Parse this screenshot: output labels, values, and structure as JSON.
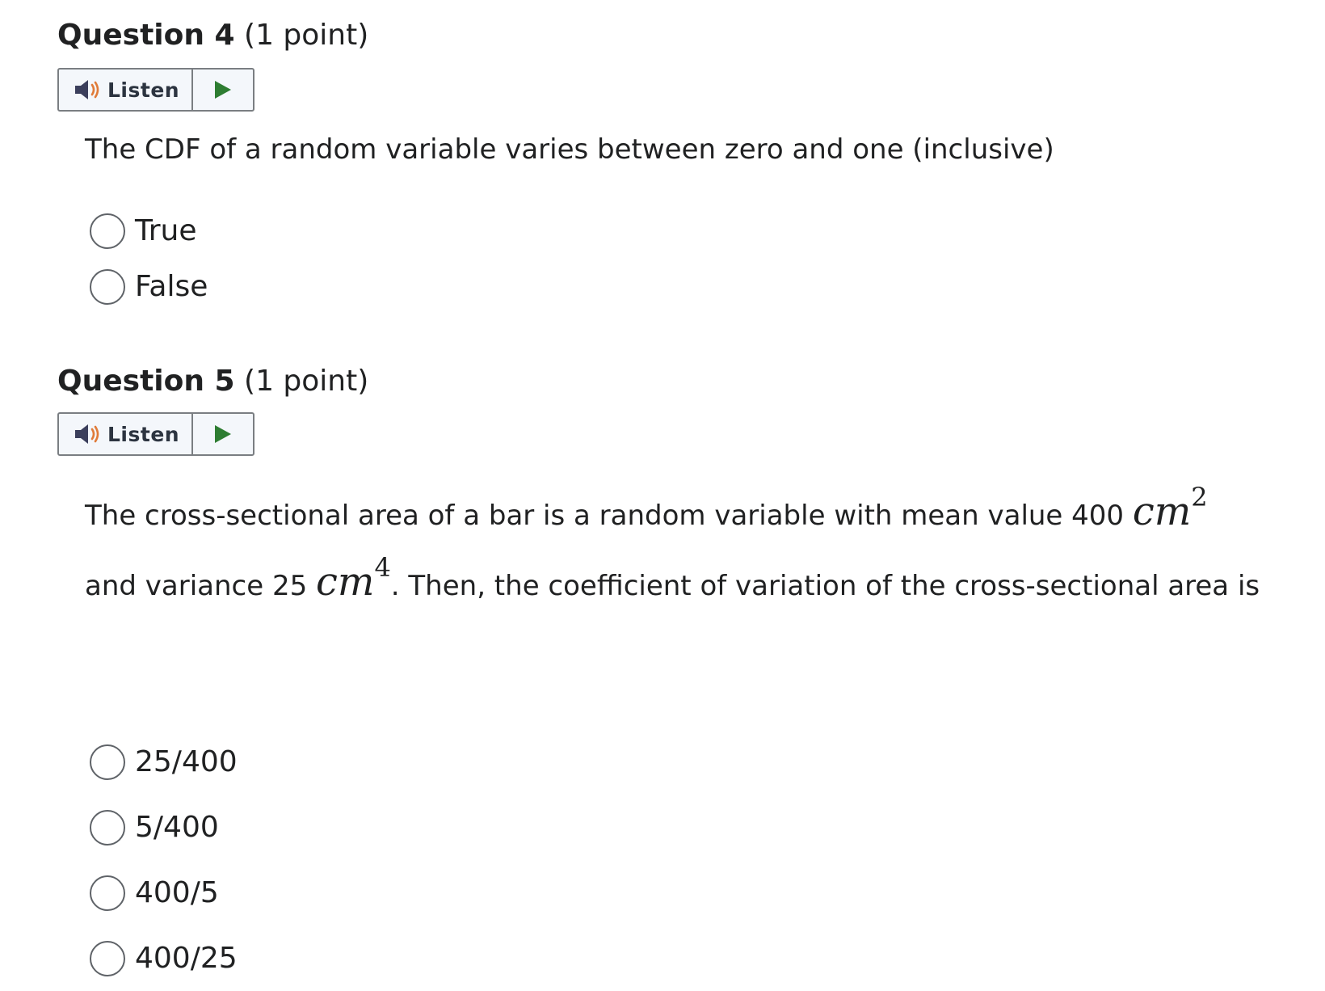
{
  "questions": [
    {
      "title": "Question 4",
      "points": "(1 point)",
      "listen": {
        "label": "Listen",
        "speaker_icon": "speaker-icon",
        "play_icon": "play-icon"
      },
      "prompt": "The CDF of a random variable varies between zero and one (inclusive)",
      "options": [
        "True",
        "False"
      ]
    },
    {
      "title": "Question 5",
      "points": "(1 point)",
      "listen": {
        "label": "Listen",
        "speaker_icon": "speaker-icon",
        "play_icon": "play-icon"
      },
      "prompt": {
        "part1": "The cross-sectional area of a bar is a random variable with mean value 400 ",
        "unit1": "cm",
        "exp1": "2",
        "part2": "and variance 25 ",
        "unit2": "cm",
        "exp2": "4",
        "part3": ". Then, the coefficient of variation of the cross-sectional area is"
      },
      "options": [
        "25/400",
        "5/400",
        "400/5",
        "400/25"
      ]
    }
  ],
  "colors": {
    "play": "#2e7d32",
    "speaker_body": "#3b3f5c",
    "speaker_waves": "#e07b39",
    "border": "#7a7e82"
  }
}
